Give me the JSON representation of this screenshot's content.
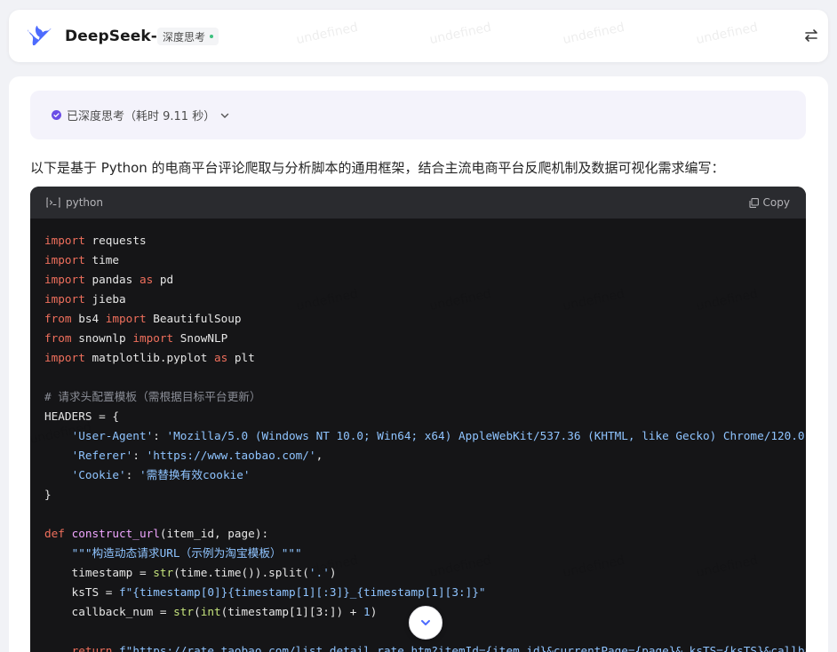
{
  "header": {
    "model_name": "DeepSeek-R1",
    "mode_badge": "深度思考"
  },
  "watermark_text": "undefined",
  "thinking": {
    "label": "已深度思考（耗时 9.11 秒）"
  },
  "message": {
    "intro": "以下是基于 Python 的电商平台评论爬取与分析脚本的通用框架，结合主流电商平台反爬机制及数据可视化需求编写："
  },
  "code_block": {
    "language": "python",
    "copy_label": "Copy"
  },
  "colors": {
    "accent": "#4d6bfe",
    "code_bg": "#151517",
    "keyword": "#ef6f5c",
    "string": "#8fc4ff"
  }
}
